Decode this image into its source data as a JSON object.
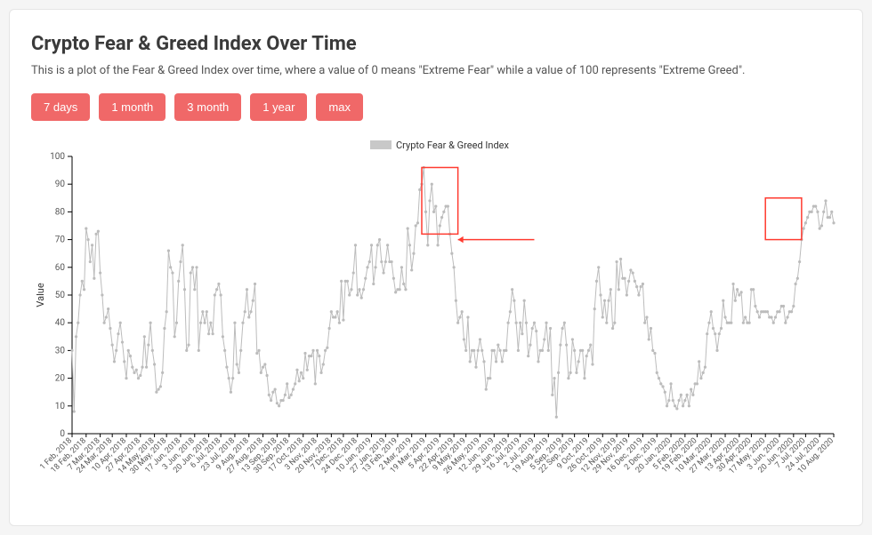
{
  "title": "Crypto Fear & Greed Index Over Time",
  "subtitle": "This is a plot of the Fear & Greed Index over time, where a value of 0 means \"Extreme Fear\" while a value of 100 represents \"Extreme Greed\".",
  "buttons": [
    "7 days",
    "1 month",
    "3 month",
    "1 year",
    "max"
  ],
  "chart_data": {
    "type": "line",
    "title": "",
    "xlabel": "",
    "ylabel": "Value",
    "ylim": [
      0,
      100
    ],
    "legend": [
      "Crypto Fear & Greed Index"
    ],
    "x_tick_labels": [
      "1 Feb, 2018",
      "18 Feb, 2018",
      "7 Mar, 2018",
      "24 Mar, 2018",
      "10 Apr, 2018",
      "27 Apr, 2018",
      "14 May, 2018",
      "30 May, 2018",
      "17 Jun, 2018",
      "3 Jun, 2018",
      "20 Jun, 2018",
      "6 Jul, 2018",
      "23 Jul, 2018",
      "9 Aug, 2018",
      "27 Aug, 2018",
      "13 Sep, 2018",
      "30 Sep, 2018",
      "17 Oct, 2018",
      "3 Nov, 2018",
      "20 Nov, 2018",
      "7 Dec, 2018",
      "24 Dec, 2018",
      "10 Jan, 2019",
      "27 Jan, 2019",
      "13 Feb, 2019",
      "2 Mar, 2019",
      "19 Mar, 2019",
      "5 Apr, 2019",
      "22 Apr, 2019",
      "9 May, 2019",
      "26 May, 2019",
      "12 Jun, 2019",
      "29 Jun, 2019",
      "16 Jul, 2019",
      "2 Jul, 2019",
      "19 Aug, 2019",
      "5 Sep, 2019",
      "22 Sep, 2019",
      "9 Oct, 2019",
      "26 Oct, 2019",
      "12 Nov, 2019",
      "29 Nov, 2019",
      "16 Dec, 2019",
      "2 Dec, 2019",
      "20 Jan, 2020",
      "5 Feb, 2020",
      "19 Feb, 2020",
      "10 Mar, 2020",
      "27 Mar, 2020",
      "13 Apr, 2020",
      "30 Apr, 2020",
      "17 May, 2020",
      "3 Jun, 2020",
      "20 Jun, 2020",
      "7 Jul, 2020",
      "24 Jul, 2020",
      "10 Aug, 2020"
    ],
    "series": [
      {
        "name": "Crypto Fear & Greed Index",
        "color": "#bcbcbc",
        "values": [
          30,
          8,
          35,
          40,
          50,
          55,
          52,
          74,
          70,
          62,
          68,
          56,
          72,
          73,
          58,
          50,
          40,
          42,
          45,
          38,
          32,
          26,
          30,
          36,
          40,
          33,
          26,
          20,
          30,
          28,
          24,
          22,
          23,
          20,
          21,
          24,
          35,
          24,
          32,
          40,
          30,
          25,
          15,
          16,
          17,
          22,
          38,
          44,
          66,
          60,
          58,
          35,
          40,
          55,
          62,
          68,
          52,
          30,
          32,
          58,
          60,
          52,
          60,
          30,
          40,
          44,
          40,
          44,
          36,
          40,
          36,
          50,
          52,
          54,
          50,
          35,
          30,
          24,
          20,
          15,
          20,
          40,
          25,
          22,
          30,
          40,
          44,
          52,
          42,
          44,
          48,
          54,
          29,
          30,
          22,
          24,
          25,
          21,
          14,
          12,
          15,
          16,
          11,
          10,
          12,
          12,
          14,
          18,
          13,
          14,
          16,
          18,
          23,
          19,
          22,
          20,
          29,
          23,
          28,
          28,
          30,
          18,
          30,
          28,
          22,
          25,
          30,
          31,
          38,
          44,
          42,
          42,
          44,
          40,
          55,
          41,
          55,
          55,
          50,
          52,
          58,
          68,
          50,
          52,
          49,
          52,
          56,
          60,
          62,
          68,
          54,
          60,
          68,
          70,
          62,
          58,
          62,
          68,
          62,
          62,
          56,
          51,
          52,
          52,
          60,
          54,
          52,
          74,
          68,
          59,
          65,
          75,
          76,
          88,
          90,
          96,
          80,
          68,
          84,
          90,
          80,
          82,
          68,
          75,
          78,
          80,
          82,
          82,
          72,
          65,
          60,
          48,
          40,
          42,
          44,
          34,
          30,
          42,
          26,
          30,
          30,
          24,
          30,
          34,
          30,
          26,
          16,
          20,
          20,
          30,
          30,
          26,
          32,
          30,
          26,
          30,
          30,
          40,
          44,
          52,
          48,
          40,
          30,
          40,
          36,
          48,
          40,
          28,
          32,
          38,
          40,
          37,
          26,
          30,
          30,
          34,
          40,
          30,
          38,
          14,
          20,
          6,
          22,
          32,
          38,
          40,
          32,
          20,
          22,
          34,
          30,
          22,
          26,
          30,
          30,
          20,
          28,
          30,
          32,
          25,
          45,
          55,
          60,
          50,
          42,
          48,
          40,
          48,
          52,
          38,
          40,
          62,
          52,
          63,
          56,
          56,
          50,
          55,
          59,
          58,
          55,
          53,
          50,
          53,
          54,
          40,
          42,
          34,
          38,
          30,
          29,
          22,
          20,
          18,
          17,
          15,
          10,
          12,
          18,
          12,
          10,
          9,
          12,
          14,
          10,
          12,
          14,
          10,
          16,
          14,
          18,
          18,
          26,
          20,
          22,
          24,
          36,
          40,
          44,
          38,
          36,
          30,
          36,
          38,
          48,
          42,
          40,
          40,
          40,
          54,
          48,
          52,
          50,
          51,
          40,
          42,
          40,
          40,
          52,
          52,
          46,
          44,
          42,
          44,
          44,
          44,
          44,
          42,
          42,
          40,
          42,
          44,
          44,
          46,
          46,
          40,
          42,
          44,
          44,
          46,
          54,
          56,
          62,
          70,
          74,
          76,
          78,
          80,
          80,
          82,
          82,
          80,
          74,
          75,
          80,
          84,
          78,
          78,
          80,
          76
        ]
      }
    ],
    "annotations": [
      {
        "type": "rect",
        "x_index_start": 174,
        "x_index_end": 192,
        "y_start": 72,
        "y_end": 96
      },
      {
        "type": "rect",
        "x_index_start": 345,
        "x_index_end": 363,
        "y_start": 70,
        "y_end": 85
      },
      {
        "type": "arrow",
        "x_from_index": 230,
        "y_from": 70,
        "x_to_index": 192,
        "y_to": 70
      }
    ]
  }
}
